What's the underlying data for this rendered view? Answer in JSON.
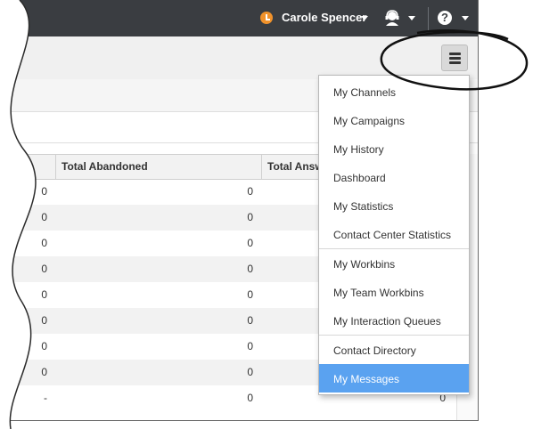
{
  "header": {
    "user_name": "Carole Spencer",
    "colors": {
      "bar": "#3a3d41",
      "status": "#f0922b",
      "accent": "#5aa2f0"
    },
    "icons": [
      "status-icon",
      "agent-headset-icon",
      "help-icon"
    ]
  },
  "table": {
    "columns": [
      "Total Abandoned",
      "Total Answ"
    ],
    "rows": [
      [
        "0",
        "0"
      ],
      [
        "0",
        "0"
      ],
      [
        "0",
        "0"
      ],
      [
        "0",
        "0"
      ],
      [
        "0",
        "0"
      ],
      [
        "0",
        "0"
      ],
      [
        "0",
        "0"
      ],
      [
        "0",
        "0"
      ],
      [
        "-",
        "0"
      ]
    ],
    "row_tail_value": "0"
  },
  "menu": {
    "groups": [
      [
        "My Channels",
        "My Campaigns",
        "My History",
        "Dashboard",
        "My Statistics",
        "Contact Center Statistics"
      ],
      [
        "My Workbins",
        "My Team Workbins",
        "My Interaction Queues"
      ],
      [
        "Contact Directory",
        "My Messages"
      ]
    ],
    "selected": "My Messages"
  }
}
